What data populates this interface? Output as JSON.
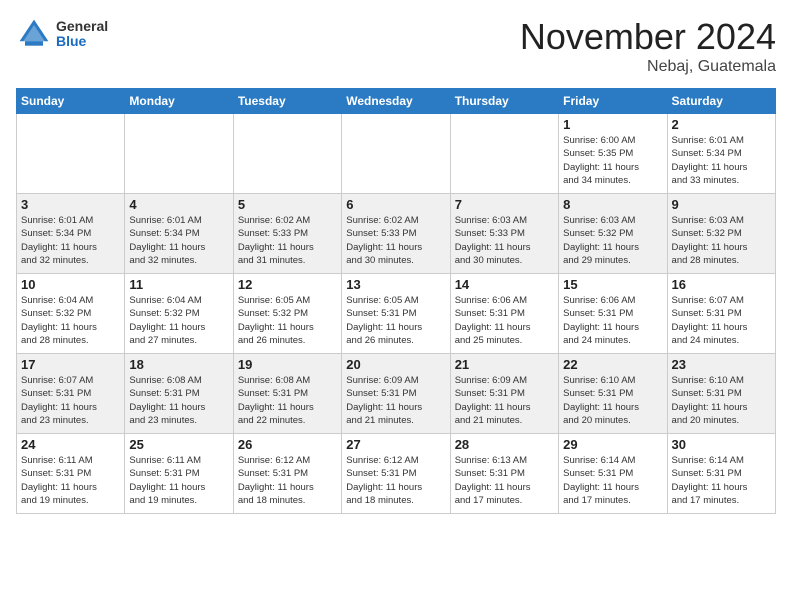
{
  "header": {
    "logo_general": "General",
    "logo_blue": "Blue",
    "month": "November 2024",
    "location": "Nebaj, Guatemala"
  },
  "calendar": {
    "headers": [
      "Sunday",
      "Monday",
      "Tuesday",
      "Wednesday",
      "Thursday",
      "Friday",
      "Saturday"
    ],
    "weeks": [
      [
        {
          "day": "",
          "info": ""
        },
        {
          "day": "",
          "info": ""
        },
        {
          "day": "",
          "info": ""
        },
        {
          "day": "",
          "info": ""
        },
        {
          "day": "",
          "info": ""
        },
        {
          "day": "1",
          "info": "Sunrise: 6:00 AM\nSunset: 5:35 PM\nDaylight: 11 hours\nand 34 minutes."
        },
        {
          "day": "2",
          "info": "Sunrise: 6:01 AM\nSunset: 5:34 PM\nDaylight: 11 hours\nand 33 minutes."
        }
      ],
      [
        {
          "day": "3",
          "info": "Sunrise: 6:01 AM\nSunset: 5:34 PM\nDaylight: 11 hours\nand 32 minutes."
        },
        {
          "day": "4",
          "info": "Sunrise: 6:01 AM\nSunset: 5:34 PM\nDaylight: 11 hours\nand 32 minutes."
        },
        {
          "day": "5",
          "info": "Sunrise: 6:02 AM\nSunset: 5:33 PM\nDaylight: 11 hours\nand 31 minutes."
        },
        {
          "day": "6",
          "info": "Sunrise: 6:02 AM\nSunset: 5:33 PM\nDaylight: 11 hours\nand 30 minutes."
        },
        {
          "day": "7",
          "info": "Sunrise: 6:03 AM\nSunset: 5:33 PM\nDaylight: 11 hours\nand 30 minutes."
        },
        {
          "day": "8",
          "info": "Sunrise: 6:03 AM\nSunset: 5:32 PM\nDaylight: 11 hours\nand 29 minutes."
        },
        {
          "day": "9",
          "info": "Sunrise: 6:03 AM\nSunset: 5:32 PM\nDaylight: 11 hours\nand 28 minutes."
        }
      ],
      [
        {
          "day": "10",
          "info": "Sunrise: 6:04 AM\nSunset: 5:32 PM\nDaylight: 11 hours\nand 28 minutes."
        },
        {
          "day": "11",
          "info": "Sunrise: 6:04 AM\nSunset: 5:32 PM\nDaylight: 11 hours\nand 27 minutes."
        },
        {
          "day": "12",
          "info": "Sunrise: 6:05 AM\nSunset: 5:32 PM\nDaylight: 11 hours\nand 26 minutes."
        },
        {
          "day": "13",
          "info": "Sunrise: 6:05 AM\nSunset: 5:31 PM\nDaylight: 11 hours\nand 26 minutes."
        },
        {
          "day": "14",
          "info": "Sunrise: 6:06 AM\nSunset: 5:31 PM\nDaylight: 11 hours\nand 25 minutes."
        },
        {
          "day": "15",
          "info": "Sunrise: 6:06 AM\nSunset: 5:31 PM\nDaylight: 11 hours\nand 24 minutes."
        },
        {
          "day": "16",
          "info": "Sunrise: 6:07 AM\nSunset: 5:31 PM\nDaylight: 11 hours\nand 24 minutes."
        }
      ],
      [
        {
          "day": "17",
          "info": "Sunrise: 6:07 AM\nSunset: 5:31 PM\nDaylight: 11 hours\nand 23 minutes."
        },
        {
          "day": "18",
          "info": "Sunrise: 6:08 AM\nSunset: 5:31 PM\nDaylight: 11 hours\nand 23 minutes."
        },
        {
          "day": "19",
          "info": "Sunrise: 6:08 AM\nSunset: 5:31 PM\nDaylight: 11 hours\nand 22 minutes."
        },
        {
          "day": "20",
          "info": "Sunrise: 6:09 AM\nSunset: 5:31 PM\nDaylight: 11 hours\nand 21 minutes."
        },
        {
          "day": "21",
          "info": "Sunrise: 6:09 AM\nSunset: 5:31 PM\nDaylight: 11 hours\nand 21 minutes."
        },
        {
          "day": "22",
          "info": "Sunrise: 6:10 AM\nSunset: 5:31 PM\nDaylight: 11 hours\nand 20 minutes."
        },
        {
          "day": "23",
          "info": "Sunrise: 6:10 AM\nSunset: 5:31 PM\nDaylight: 11 hours\nand 20 minutes."
        }
      ],
      [
        {
          "day": "24",
          "info": "Sunrise: 6:11 AM\nSunset: 5:31 PM\nDaylight: 11 hours\nand 19 minutes."
        },
        {
          "day": "25",
          "info": "Sunrise: 6:11 AM\nSunset: 5:31 PM\nDaylight: 11 hours\nand 19 minutes."
        },
        {
          "day": "26",
          "info": "Sunrise: 6:12 AM\nSunset: 5:31 PM\nDaylight: 11 hours\nand 18 minutes."
        },
        {
          "day": "27",
          "info": "Sunrise: 6:12 AM\nSunset: 5:31 PM\nDaylight: 11 hours\nand 18 minutes."
        },
        {
          "day": "28",
          "info": "Sunrise: 6:13 AM\nSunset: 5:31 PM\nDaylight: 11 hours\nand 17 minutes."
        },
        {
          "day": "29",
          "info": "Sunrise: 6:14 AM\nSunset: 5:31 PM\nDaylight: 11 hours\nand 17 minutes."
        },
        {
          "day": "30",
          "info": "Sunrise: 6:14 AM\nSunset: 5:31 PM\nDaylight: 11 hours\nand 17 minutes."
        }
      ]
    ]
  }
}
